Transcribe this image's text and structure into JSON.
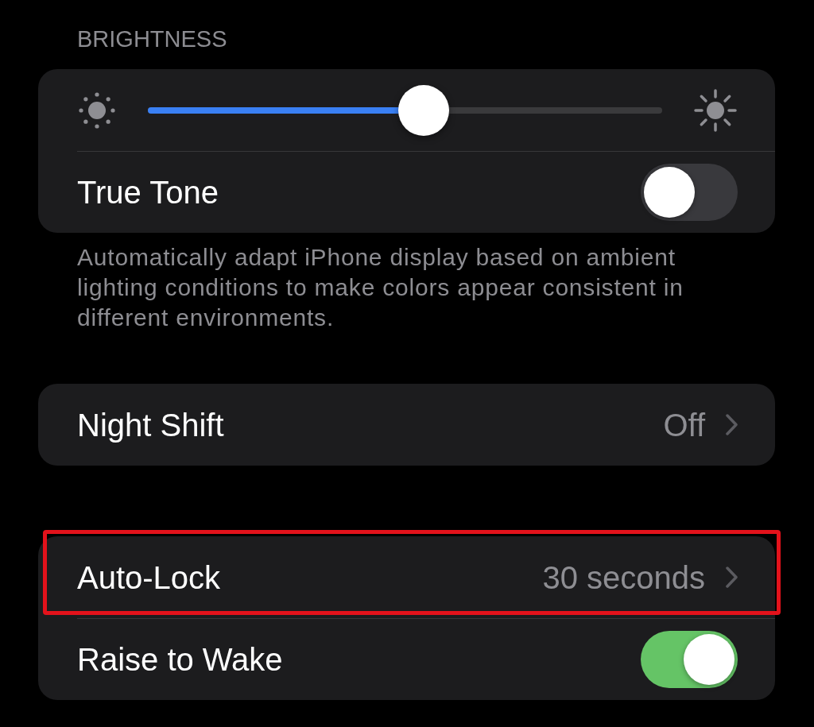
{
  "sections": [
    {
      "header": "BRIGHTNESS",
      "rows": [
        {
          "kind": "slider",
          "level": 0.54
        },
        {
          "kind": "toggle",
          "label": "True Tone",
          "on": false
        }
      ],
      "footer": "Automatically adapt iPhone display based on ambient lighting conditions to make colors appear consistent in different environments."
    },
    {
      "rows": [
        {
          "kind": "link",
          "label": "Night Shift",
          "value": "Off",
          "highlighted": false
        }
      ]
    },
    {
      "rows": [
        {
          "kind": "link",
          "label": "Auto-Lock",
          "value": "30 seconds",
          "highlighted": true
        },
        {
          "kind": "toggle",
          "label": "Raise to Wake",
          "on": true
        }
      ]
    }
  ]
}
